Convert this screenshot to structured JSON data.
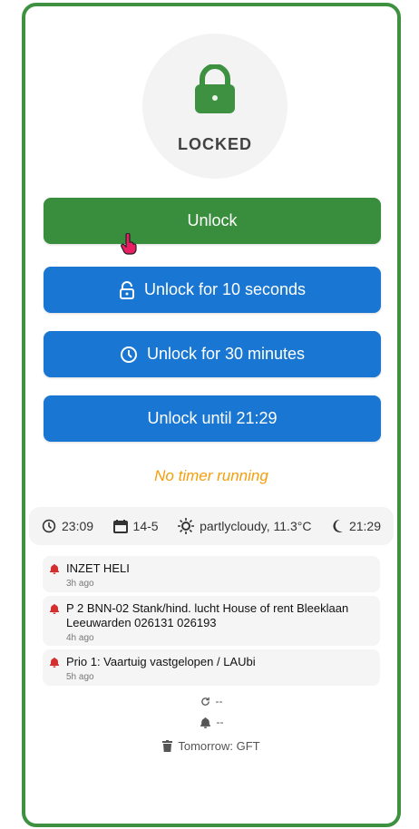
{
  "lock": {
    "status": "LOCKED",
    "color": "#3d9140"
  },
  "buttons": {
    "unlock": "Unlock",
    "unlock_10s": "Unlock for 10 seconds",
    "unlock_30m": "Unlock for 30 minutes",
    "unlock_until": "Unlock until 21:29"
  },
  "timer": {
    "status": "No timer running"
  },
  "info_bar": {
    "time": "23:09",
    "date": "14-5",
    "weather": "partlycloudy, 11.3°C",
    "moon_time": "21:29"
  },
  "alerts": [
    {
      "title": "INZET HELI",
      "age": "3h ago"
    },
    {
      "title": "P 2 BNN-02 Stank/hind. lucht House of rent Bleeklaan Leeuwarden 026131 026193",
      "age": "4h ago"
    },
    {
      "title": "Prio 1: Vaartuig vastgelopen / LAUbi",
      "age": "5h ago"
    }
  ],
  "footer": {
    "refresh_value": "--",
    "alarm_value": "--",
    "waste": "Tomorrow: GFT"
  },
  "icons": {
    "lock": "lock-icon",
    "open_lock": "lock-open-icon",
    "clock": "clock-icon",
    "calendar": "calendar-icon",
    "sun": "sun-icon",
    "moon": "moon-icon",
    "alarm_bell": "alarm-bell-icon",
    "refresh": "refresh-icon",
    "trash": "trash-icon"
  }
}
